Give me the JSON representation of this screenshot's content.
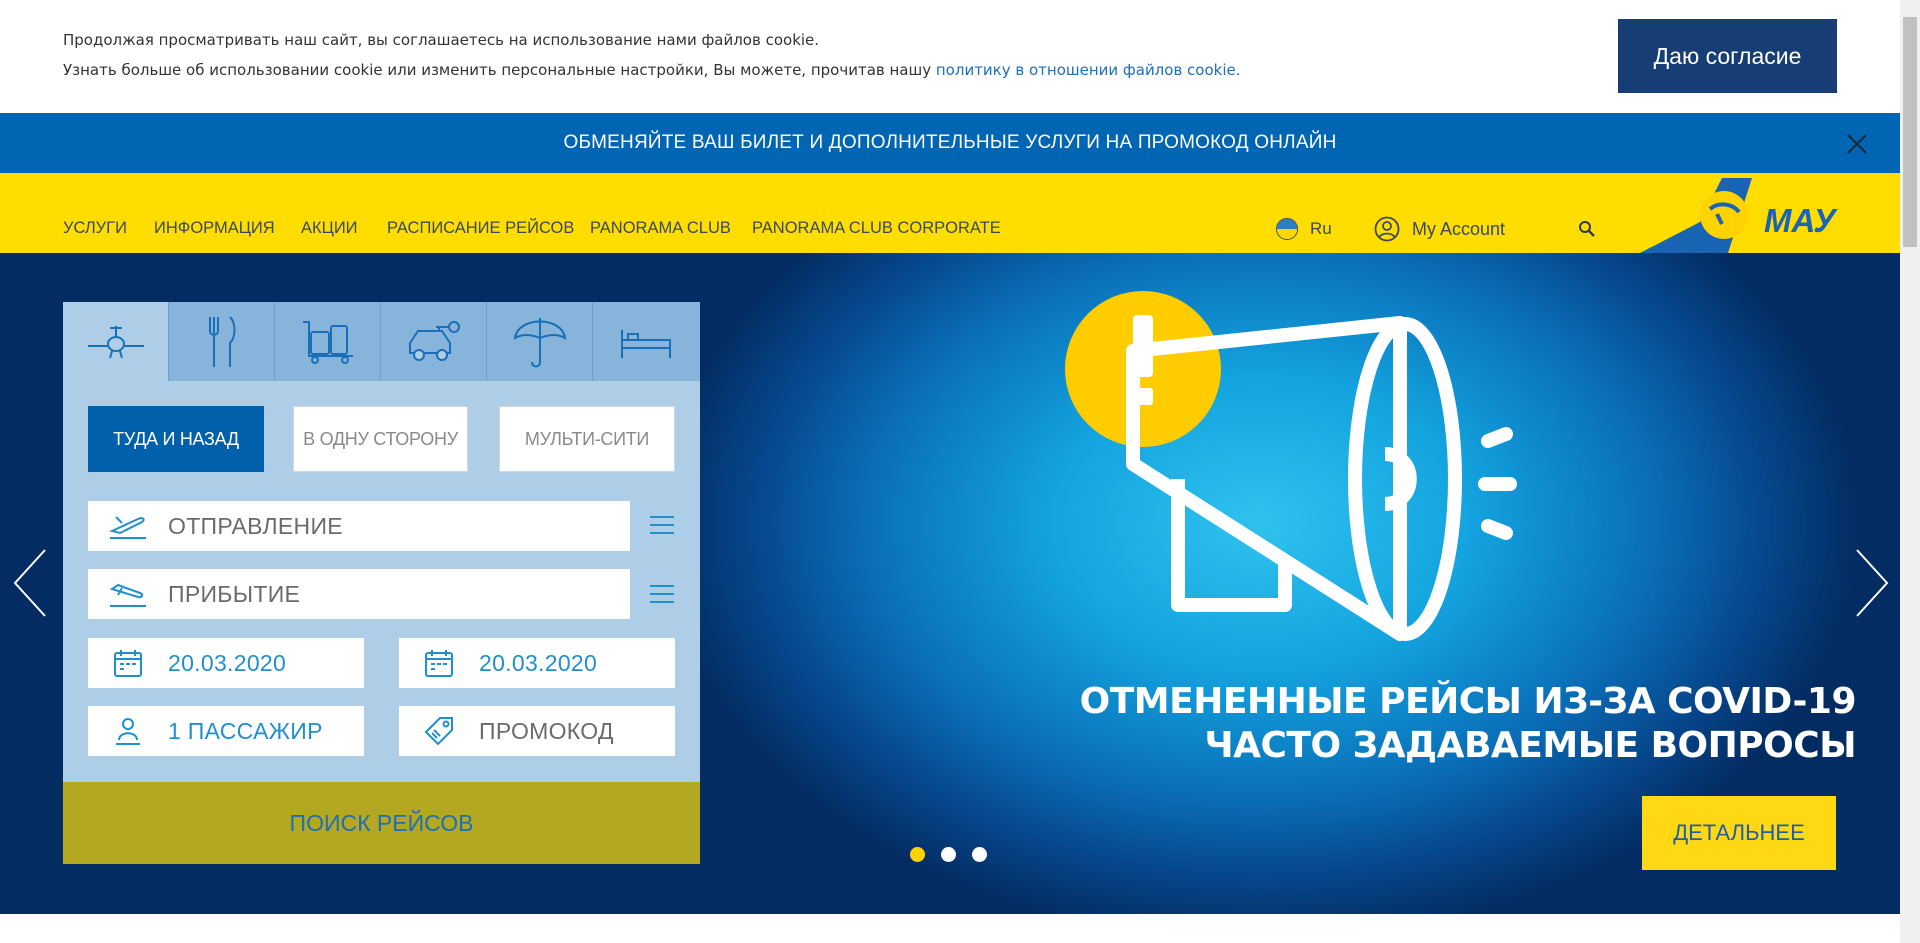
{
  "cookie": {
    "line1": "Продолжая просматривать наш сайт, вы соглашаетесь на использование нами файлов cookie.",
    "line2_prefix": "Узнать больше об использовании cookie или изменить персональные настройки, Вы можете, прочитав нашу ",
    "line2_link": "политику в отношении файлов cookie.",
    "accept_label": "Даю согласие"
  },
  "promo": {
    "text": "ОБМЕНЯЙТЕ ВАШ БИЛЕТ И ДОПОЛНИТЕЛЬНЫЕ УСЛУГИ НА ПРОМОКОД ОНЛАЙН"
  },
  "nav": {
    "items": [
      {
        "label": "УСЛУГИ"
      },
      {
        "label": "ИНФОРМАЦИЯ"
      },
      {
        "label": "АКЦИИ"
      },
      {
        "label": "РАСПИСАНИЕ РЕЙСОВ"
      },
      {
        "label": "PANORAMA CLUB"
      },
      {
        "label": "PANORAMA CLUB CORPORATE"
      }
    ],
    "language": "Ru",
    "account_label": "My Account",
    "logo_text": "МАУ"
  },
  "booking": {
    "tab_icons": [
      "plane-icon",
      "cutlery-icon",
      "luggage-icon",
      "car-rental-icon",
      "umbrella-icon",
      "bed-icon"
    ],
    "trip_types": [
      "ТУДА И НАЗАД",
      "В ОДНУ СТОРОНУ",
      "МУЛЬТИ-СИТИ"
    ],
    "departure_placeholder": "ОТПРАВЛЕНИЕ",
    "arrival_placeholder": "ПРИБЫТИЕ",
    "date_from": "20.03.2020",
    "date_to": "20.03.2020",
    "passengers": "1 ПАССАЖИР",
    "promo_code_placeholder": "ПРОМОКОД",
    "search_label": "ПОИСК РЕЙСОВ"
  },
  "slide": {
    "title_line1": "ОТМЕНЕННЫЕ РЕЙСЫ ИЗ-ЗА COVID-19",
    "title_line2": "ЧАСТО ЗАДАВАЕМЫЕ ВОПРОСЫ",
    "button_label": "ДЕТАЛЬНЕЕ",
    "total_slides": 3,
    "active_slide": 1
  },
  "colors": {
    "nav_bg": "#ffdd00",
    "promo_bg": "#0066b3",
    "cookie_button": "#163e74",
    "search_button": "#b3a820",
    "active_trip": "#0060ab"
  }
}
